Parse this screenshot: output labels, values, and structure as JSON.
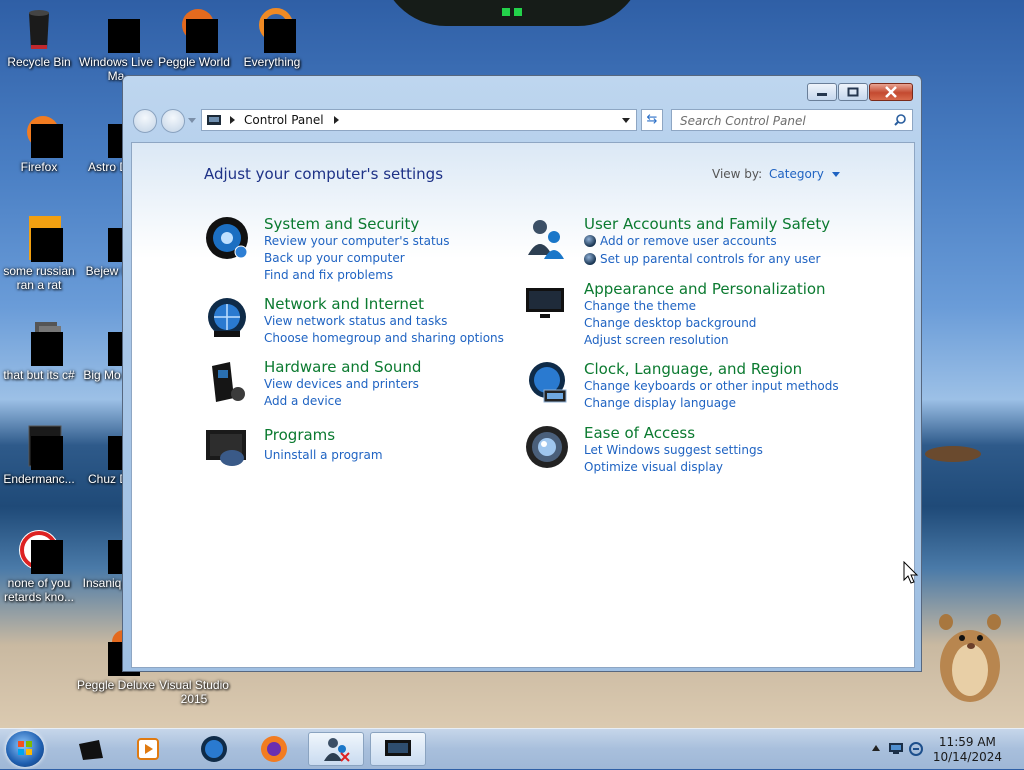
{
  "desktop": {
    "icons": [
      {
        "label": "Recycle Bin"
      },
      {
        "label": "Windows Live Ma"
      },
      {
        "label": "Peggle World"
      },
      {
        "label": "Everything"
      },
      {
        "label": "Firefox"
      },
      {
        "label": "Astro Delu"
      },
      {
        "label": "some russian ran a rat"
      },
      {
        "label": "Bejew Delu"
      },
      {
        "label": "that but its c#"
      },
      {
        "label": "Big Mo Delu"
      },
      {
        "label": "Endermanc..."
      },
      {
        "label": "Chuz Delu"
      },
      {
        "label": "none of you retards kno..."
      },
      {
        "label": "Insaniq Delu"
      },
      {
        "label": "Peggle Deluxe"
      },
      {
        "label": "Visual Studio 2015"
      }
    ]
  },
  "window": {
    "address": {
      "crumb": "Control Panel"
    },
    "search": {
      "placeholder": "Search Control Panel"
    },
    "page_title": "Adjust your computer's settings",
    "view_by": {
      "label": "View by:",
      "value": "Category"
    },
    "categories": [
      {
        "title": "System and Security",
        "icon": "system-security-icon",
        "links": [
          "Review your computer's status",
          "Back up your computer",
          "Find and fix problems"
        ]
      },
      {
        "title": "Network and Internet",
        "icon": "network-internet-icon",
        "links": [
          "View network status and tasks",
          "Choose homegroup and sharing options"
        ]
      },
      {
        "title": "Hardware and Sound",
        "icon": "hardware-sound-icon",
        "links": [
          "View devices and printers",
          "Add a device"
        ]
      },
      {
        "title": "Programs",
        "icon": "programs-icon",
        "links": [
          "Uninstall a program"
        ]
      },
      {
        "title": "User Accounts and Family Safety",
        "icon": "user-accounts-icon",
        "links": [
          "Add or remove user accounts",
          "Set up parental controls for any user"
        ]
      },
      {
        "title": "Appearance and Personalization",
        "icon": "appearance-icon",
        "links": [
          "Change the theme",
          "Change desktop background",
          "Adjust screen resolution"
        ]
      },
      {
        "title": "Clock, Language, and Region",
        "icon": "clock-language-icon",
        "links": [
          "Change keyboards or other input methods",
          "Change display language"
        ]
      },
      {
        "title": "Ease of Access",
        "icon": "ease-of-access-icon",
        "links": [
          "Let Windows suggest settings",
          "Optimize visual display"
        ]
      }
    ]
  },
  "taskbar": {
    "items": [
      "start-orb",
      "black-cube",
      "media-player",
      "globe",
      "firefox",
      "user-accounts",
      "control-panel"
    ],
    "clock": {
      "time": "11:59 AM",
      "date": "10/14/2024"
    }
  },
  "colors": {
    "link": "#1f63c2",
    "category_title": "#0b7a30",
    "page_title": "#1e3287"
  }
}
